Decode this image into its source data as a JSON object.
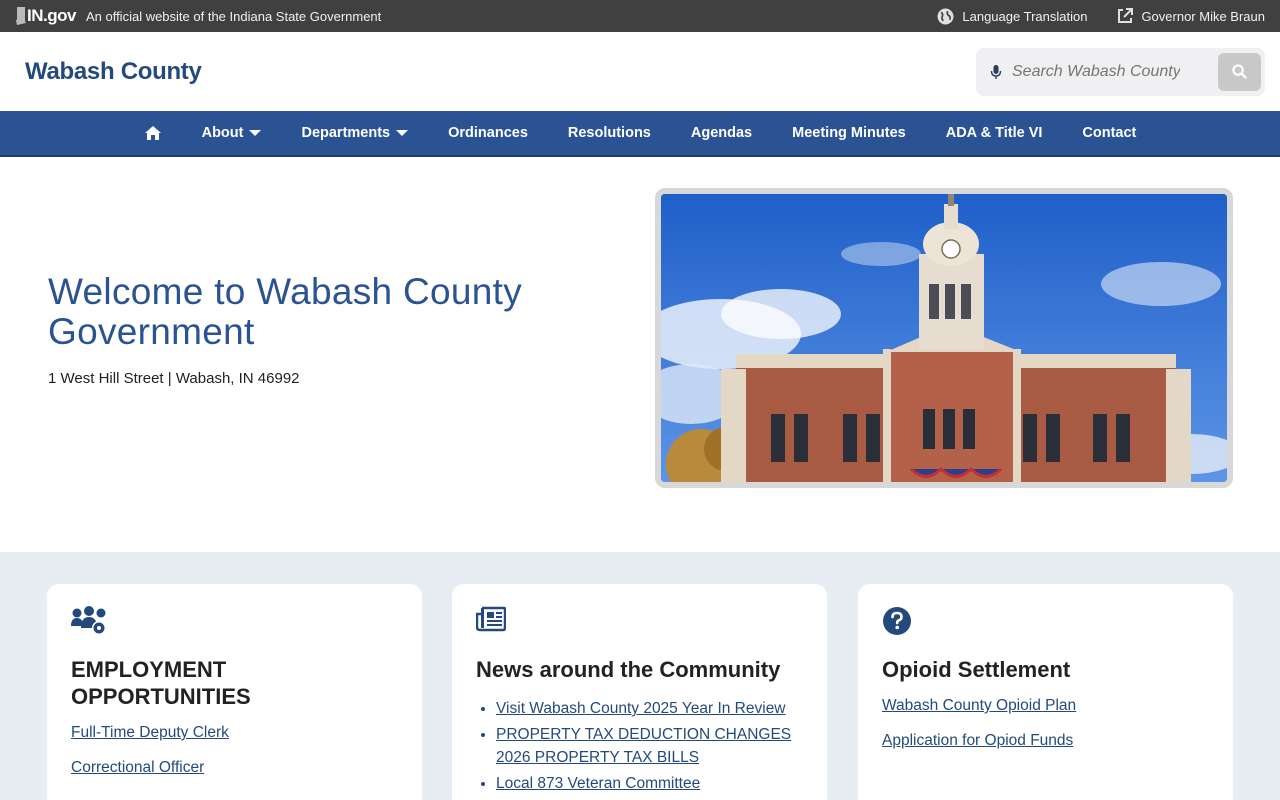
{
  "topbar": {
    "logo_text": "IN.gov",
    "official_text": "An official website of the Indiana State Government",
    "language_label": "Language Translation",
    "governor_label": "Governor Mike Braun"
  },
  "header": {
    "title": "Wabash County",
    "search_placeholder": "Search Wabash County"
  },
  "nav": {
    "items": [
      {
        "label": "About"
      },
      {
        "label": "Departments"
      },
      {
        "label": "Ordinances"
      },
      {
        "label": "Resolutions"
      },
      {
        "label": "Agendas"
      },
      {
        "label": "Meeting Minutes"
      },
      {
        "label": "ADA & Title VI"
      },
      {
        "label": "Contact"
      }
    ]
  },
  "hero": {
    "title": "Welcome to Wabash County Government",
    "address": "1 West Hill Street | Wabash, IN 46992"
  },
  "cards": [
    {
      "icon": "people-gear-icon",
      "title": "EMPLOYMENT OPPORTUNITIES",
      "links": [
        "Full-Time Deputy Clerk",
        "Correctional Officer"
      ]
    },
    {
      "icon": "newspaper-icon",
      "title": "News around the Community",
      "links": [
        "Visit Wabash County 2025 Year In Review",
        "PROPERTY TAX DEDUCTION CHANGES 2026 PROPERTY TAX BILLS",
        "Local 873 Veteran Committee"
      ]
    },
    {
      "icon": "question-circle-icon",
      "title": "Opioid Settlement",
      "links": [
        "Wabash County Opioid Plan",
        "Application for Opiod Funds"
      ]
    }
  ],
  "colors": {
    "brand_blue": "#2b5393",
    "title_blue": "#244a7c",
    "topbar_bg": "#404040",
    "section_bg": "#e8ecf3"
  }
}
